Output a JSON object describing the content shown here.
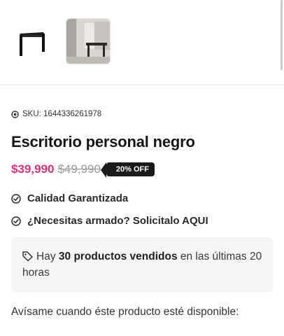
{
  "product": {
    "sku_label": "SKU: 1644336261978",
    "title": "Escritorio personal negro",
    "price": "$39,990",
    "old_price": "$49,990",
    "discount_badge": "20% OFF"
  },
  "features": [
    {
      "icon": "check-circle-icon",
      "label": "Calidad Garantizada"
    },
    {
      "icon": "check-circle-icon",
      "label": "¿Necesitas armado? Solicitalo AQUI"
    }
  ],
  "sales_info": {
    "icon": "tag-icon",
    "prefix": "Hay",
    "highlight": "30 productos vendidos",
    "suffix": "en las últimas 20 horas"
  },
  "notify_text": "Avísame cuando éste producto esté disponible:",
  "colors": {
    "price": "#e0307c",
    "badge_bg": "#1a1a1a"
  }
}
